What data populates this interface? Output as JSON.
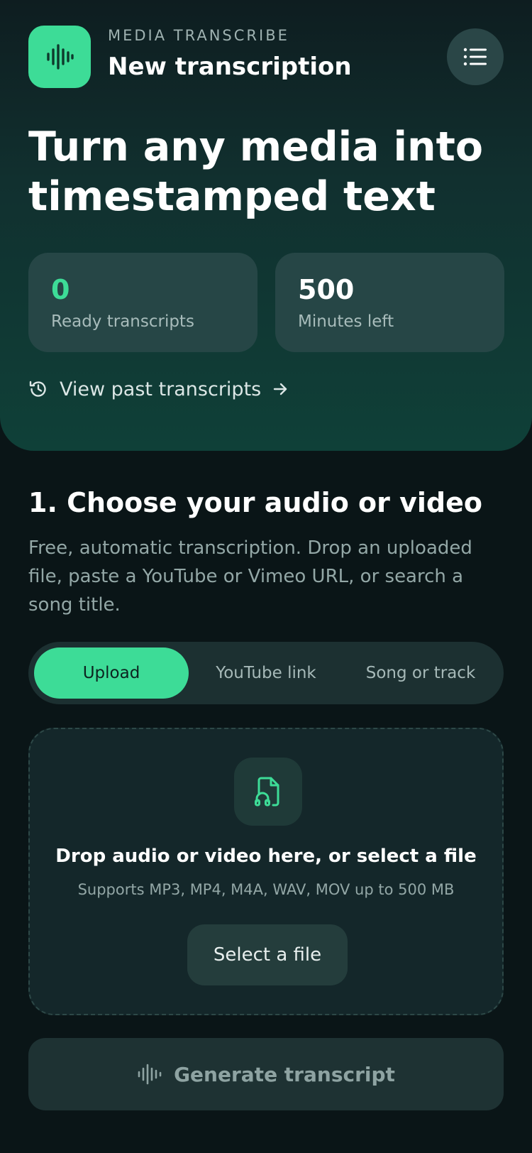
{
  "header": {
    "app_name": "MEDIA TRANSCRIBE",
    "title": "New transcription",
    "logo_icon": "waveform-icon",
    "menu_icon": "list-icon"
  },
  "hero": {
    "headline": "Turn any media into timestamped text",
    "stats": [
      {
        "value": "0",
        "label": "Ready transcripts",
        "color": "#3ddc97"
      },
      {
        "value": "500",
        "label": "Minutes left",
        "color": "#ffffff"
      }
    ],
    "history_link": "View past transcripts"
  },
  "section": {
    "title": "1. Choose your audio or video",
    "description": "Free, automatic transcription. Drop an uploaded file, paste a YouTube or Vimeo URL, or search a song title."
  },
  "tabs": [
    {
      "label": "Upload",
      "active": true
    },
    {
      "label": "YouTube link",
      "active": false
    },
    {
      "label": "Song or track",
      "active": false
    }
  ],
  "dropzone": {
    "icon": "audio-file-icon",
    "title": "Drop audio or video here, or select a file",
    "subtitle": "Supports MP3, MP4, M4A, WAV, MOV up to 500 MB",
    "button_label": "Select a file"
  },
  "generate_button": {
    "label": "Generate transcript",
    "icon": "waveform-icon"
  },
  "colors": {
    "accent": "#3ddc97",
    "background": "#0a1517"
  }
}
